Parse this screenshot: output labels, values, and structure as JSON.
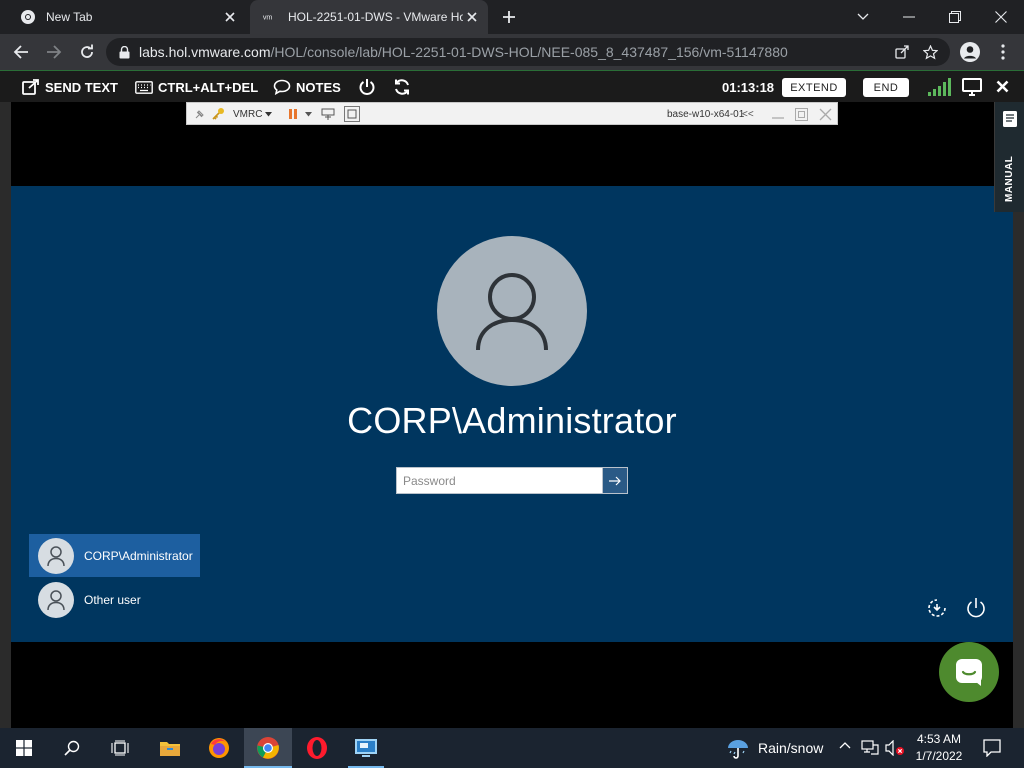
{
  "browser": {
    "tabs": [
      {
        "title": "New Tab",
        "favicon": "chrome-icon"
      },
      {
        "title": "HOL-2251-01-DWS - VMware Ho",
        "favicon": "vmware-icon",
        "favicon_text": "vm",
        "active": true
      }
    ],
    "address": {
      "host": "labs.hol.vmware.com",
      "path": "/HOL/console/lab/HOL-2251-01-DWS-HOL/NEE-085_8_437487_156/vm-51147880"
    }
  },
  "hol_bar": {
    "send_text": "SEND TEXT",
    "ctrl_alt_del": "CTRL+ALT+DEL",
    "notes": "NOTES",
    "timer": "01:13:18",
    "extend": "EXTEND",
    "end": "END"
  },
  "vmrc": {
    "menu": "VMRC",
    "vm_name": "base-w10-x64-01",
    "collapse": "<<"
  },
  "manual_tab": {
    "label": "MANUAL"
  },
  "lockscreen": {
    "username": "CORP\\Administrator",
    "password_placeholder": "Password",
    "users": [
      {
        "name": "CORP\\Administrator",
        "selected": true
      },
      {
        "name": "Other user",
        "selected": false
      }
    ]
  },
  "taskbar": {
    "weather": "Rain/snow",
    "time": "4:53 AM",
    "date": "1/7/2022"
  },
  "colors": {
    "lock_bg": "#00365f",
    "selected_user": "#1d5fa0",
    "signal_green": "#5cb85c",
    "chat_bubble": "#4e8a2e"
  }
}
